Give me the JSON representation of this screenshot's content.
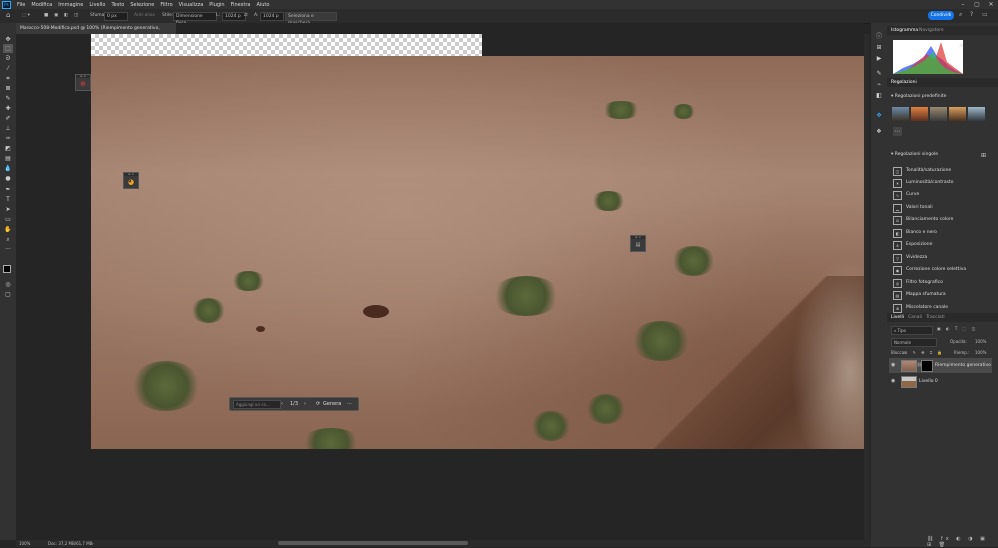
{
  "menubar": {
    "logo": "Ps",
    "items": [
      "File",
      "Modifica",
      "Immagine",
      "Livello",
      "Testo",
      "Selezione",
      "Filtro",
      "Visualizza",
      "Plugin",
      "Finestra",
      "Aiuto"
    ]
  },
  "optbar": {
    "feather_label": "Sfuma:",
    "feather_value": "0 px",
    "antialias_label": "Anti-alias",
    "style_label": "Stile:",
    "style_value": "Dimensione fissa",
    "width_label": "L:",
    "width_value": "1024 p",
    "height_label": "A:",
    "height_value": "1024 p",
    "select_mask": "Seleziona e maschera...",
    "share": "Condividi"
  },
  "tab": {
    "title": "Marocco-508-Modifica.psd @ 100% (Riempimento generativo, RGB/16) *",
    "close": "×"
  },
  "ctxbar": {
    "placeholder": "Aggiungi un co...",
    "page": "1/3",
    "generate": "Genera",
    "more": "···"
  },
  "status": {
    "zoom": "100%",
    "doc": "Doc: 37,2 MB/61,7 MB"
  },
  "panels": {
    "histogram_tabs": [
      "Istogramma",
      "Navigatore"
    ],
    "adjust_tab": "Regolazioni",
    "presets_title": "Regolazioni predefinite",
    "single_title": "Regolazioni singole",
    "adjustments": [
      "Tonalità/saturazione",
      "Luminosità/contrasto",
      "Curve",
      "Valori tonali",
      "Bilanciamento colore",
      "Bianco e nero",
      "Esposizione",
      "Vividezza",
      "Correzione colore selettiva",
      "Filtro fotografico",
      "Mappa sfumatura",
      "Miscelatore canale"
    ],
    "layer_tabs": [
      "Livelli",
      "Canali",
      "Tracciati"
    ],
    "kind": "Tipo",
    "blend": "Normale",
    "opacity_label": "Opacità:",
    "opacity_value": "100%",
    "lock_label": "Blocca:",
    "fill_label": "Riemp.:",
    "fill_value": "100%",
    "layers": [
      "Riempimento generativo",
      "Livello 0"
    ]
  },
  "colors": {
    "accent": "#1473e6",
    "panel": "#323232",
    "canvas_bg": "#252525"
  }
}
